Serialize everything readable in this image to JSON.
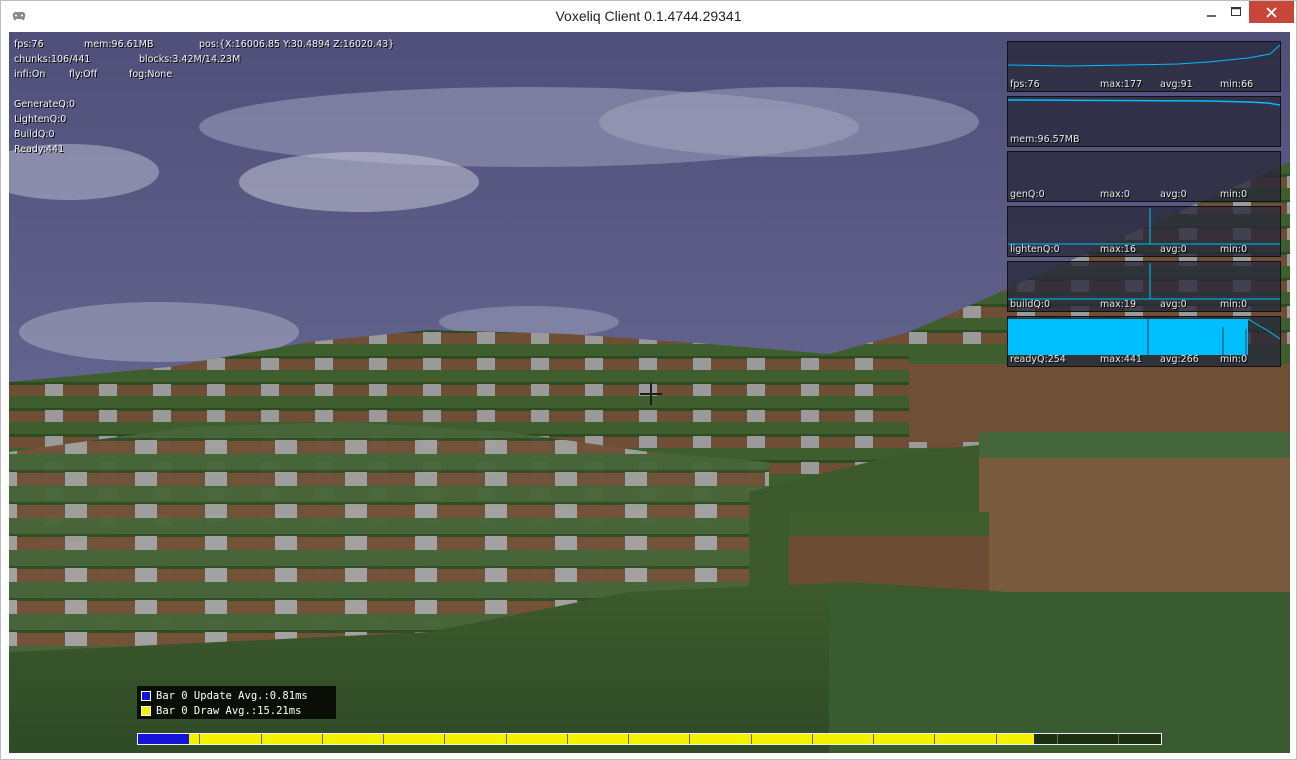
{
  "window": {
    "title": "Voxeliq Client 0.1.4744.29341",
    "icon": "gamepad-icon",
    "controls": [
      "minimize-icon",
      "maximize-icon",
      "close-icon"
    ],
    "close_color": "#c7463a"
  },
  "stats": {
    "fps": "fps:76",
    "mem": "mem:96.61MB",
    "pos": "pos:{X:16006.85 Y:30.4894 Z:16020.43}",
    "chunks": "chunks:106/441",
    "blocks": "blocks:3.42M/14.23M",
    "infi": "infi:On",
    "fly": "fly:Off",
    "fog": "fog:None"
  },
  "queues": {
    "generate": "GenerateQ:0",
    "lighten": "LightenQ:0",
    "build": "BuildQ:0",
    "ready": "Ready:441"
  },
  "graphs": [
    {
      "id": "fps",
      "label": "fps:76",
      "max": "max:177",
      "avg": "avg:91",
      "min": "min:66"
    },
    {
      "id": "mem",
      "label": "mem:96.57MB",
      "max": "",
      "avg": "",
      "min": ""
    },
    {
      "id": "genq",
      "label": "genQ:0",
      "max": "max:0",
      "avg": "avg:0",
      "min": "min:0"
    },
    {
      "id": "lightenq",
      "label": "lightenQ:0",
      "max": "max:16",
      "avg": "avg:0",
      "min": "min:0"
    },
    {
      "id": "buildq",
      "label": "buildQ:0",
      "max": "max:19",
      "avg": "avg:0",
      "min": "min:0"
    },
    {
      "id": "readyq",
      "label": "readyQ:254",
      "max": "max:441",
      "avg": "avg:266",
      "min": "min:0"
    }
  ],
  "graph_color": "#00bfff",
  "legend": {
    "update": {
      "text": "Bar 0 Update Avg.:0.81ms",
      "color": "#1414d8"
    },
    "draw": {
      "text": "Bar 0 Draw Avg.:15.21ms",
      "color": "#f3f200"
    }
  },
  "perf_bar": {
    "update_fraction": 0.05,
    "draw_fraction": 0.876
  }
}
